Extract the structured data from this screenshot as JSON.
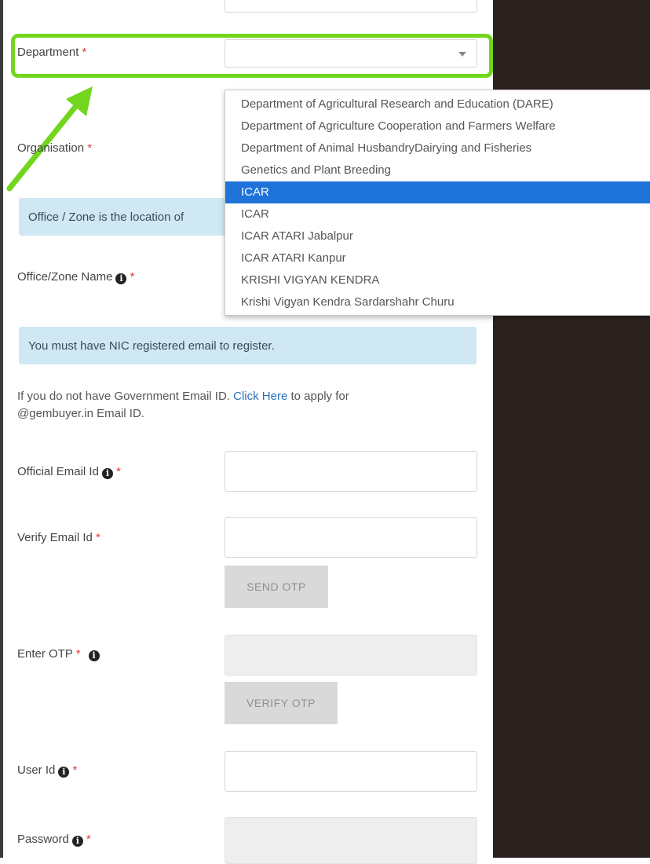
{
  "form": {
    "department": {
      "label": "Department",
      "required": "*",
      "value": ""
    },
    "organisation": {
      "label": "Organisation",
      "required": "*"
    },
    "office_zone_alert": "Office / Zone is the location of",
    "office_zone_name": {
      "label": "Office/Zone Name",
      "required": "*"
    },
    "nic_alert": "You must have NIC registered email to register.",
    "gov_email_note": {
      "text_before": "If you do not have Government Email ID.",
      "link": "Click Here",
      "text_after": "to apply for",
      "line2": "@gembuyer.in Email ID."
    },
    "official_email": {
      "label": "Official Email Id",
      "required": "*",
      "value": ""
    },
    "verify_email": {
      "label": "Verify Email Id",
      "required": "*",
      "value": ""
    },
    "send_otp_label": "SEND OTP",
    "enter_otp": {
      "label": "Enter OTP",
      "required": "*",
      "value": ""
    },
    "verify_otp_label": "VERIFY OTP",
    "user_id": {
      "label": "User Id",
      "required": "*",
      "value": ""
    },
    "password": {
      "label": "Password",
      "required": "*",
      "value": ""
    }
  },
  "department_dropdown": {
    "options": [
      "Department of Agricultural Research and Education (DARE)",
      "Department of Agriculture Cooperation and Farmers Welfare",
      "Department of Animal HusbandryDairying and Fisheries",
      "Genetics and Plant Breeding",
      "ICAR",
      "ICAR",
      "ICAR ATARI Jabalpur",
      "ICAR ATARI Kanpur",
      "KRISHI VIGYAN KENDRA",
      "Krishi Vigyan Kendra Sardarshahr Churu"
    ],
    "selected_index": 4
  },
  "icons": {
    "dropdown_caret": "chevron-down-icon",
    "info": "info-icon",
    "annotation_arrow": "arrow-icon"
  },
  "colors": {
    "highlight": "#72d61e",
    "selected_option": "#1e73d8",
    "alert_background": "#cfe8f3",
    "required": "#e03a3a",
    "right_panel": "#2b221f"
  }
}
